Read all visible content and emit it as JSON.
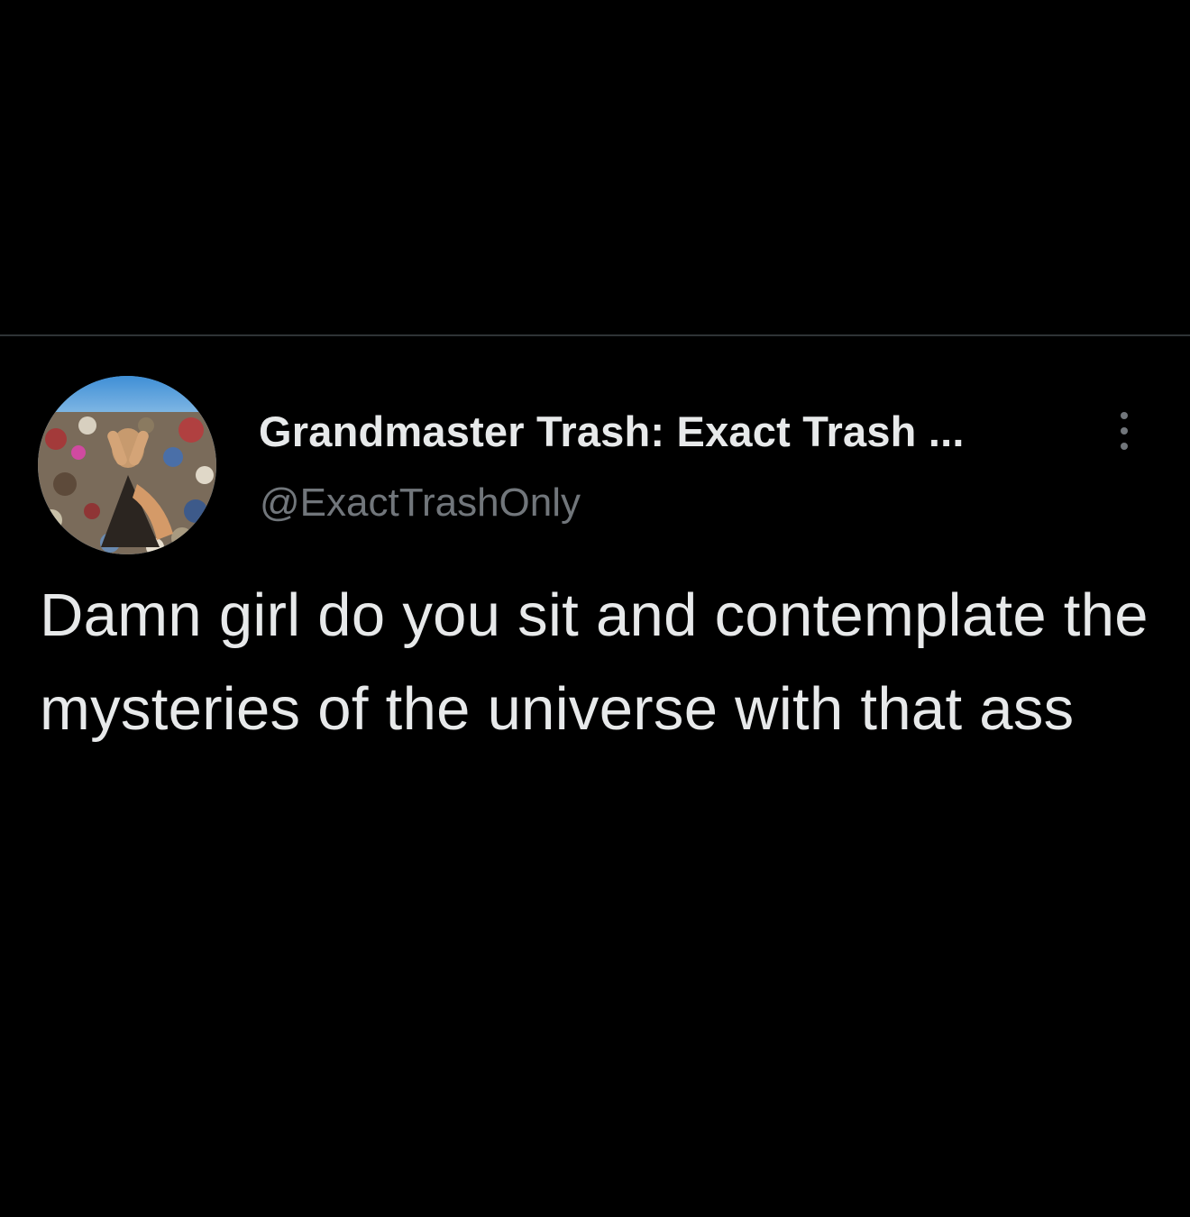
{
  "tweet": {
    "author": {
      "display_name": "Grandmaster Trash: Exact Trash ...",
      "handle": "@ExactTrashOnly",
      "avatar_icon": "avatar-image"
    },
    "menu_icon": "more-vertical-icon",
    "text": "Damn girl do you sit and contemplate the mysteries of the universe with that ass"
  },
  "theme": {
    "background": "#000000",
    "text_primary": "#e7e9ea",
    "text_secondary": "#71767b",
    "divider": "#2f3336"
  }
}
